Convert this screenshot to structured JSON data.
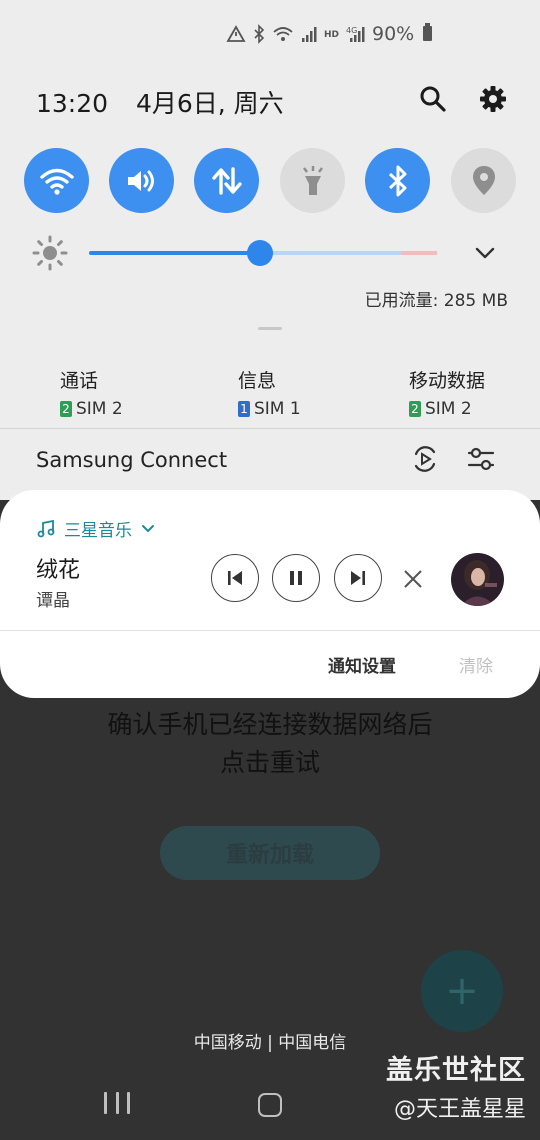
{
  "status_bar": {
    "battery_text": "90%"
  },
  "header": {
    "time": "13:20",
    "date": "4月6日, 周六"
  },
  "quick_tiles": [
    {
      "name": "wifi",
      "state": "on"
    },
    {
      "name": "sound",
      "state": "on"
    },
    {
      "name": "mobile-data",
      "state": "on"
    },
    {
      "name": "flashlight",
      "state": "off"
    },
    {
      "name": "bluetooth",
      "state": "on"
    },
    {
      "name": "location",
      "state": "off"
    }
  ],
  "brightness": {
    "level": 0.49
  },
  "data_usage": "已用流量: 285 MB",
  "sim_settings": [
    {
      "label": "通话",
      "sim_number": "2",
      "sim_text": "SIM 2"
    },
    {
      "label": "信息",
      "sim_number": "1",
      "sim_text": "SIM 1"
    },
    {
      "label": "移动数据",
      "sim_number": "2",
      "sim_text": "SIM 2"
    }
  ],
  "samsung_connect": {
    "label": "Samsung Connect"
  },
  "media": {
    "app_name": "三星音乐",
    "title": "绒花",
    "artist": "谭晶",
    "notification_settings": "通知设置",
    "clear": "清除"
  },
  "background_app": {
    "message_line1": "确认手机已经连接数据网络后",
    "message_line2": "点击重试",
    "reload_button": "重新加载",
    "fab_label": "+"
  },
  "carrier": "中国移动 | 中国电信",
  "watermark": {
    "line1": "盖乐世社区",
    "line2": "@天王盖星星"
  },
  "colors": {
    "accent": "#3d8ff0",
    "media_app": "#1a8a98",
    "scrim": "#323232"
  }
}
